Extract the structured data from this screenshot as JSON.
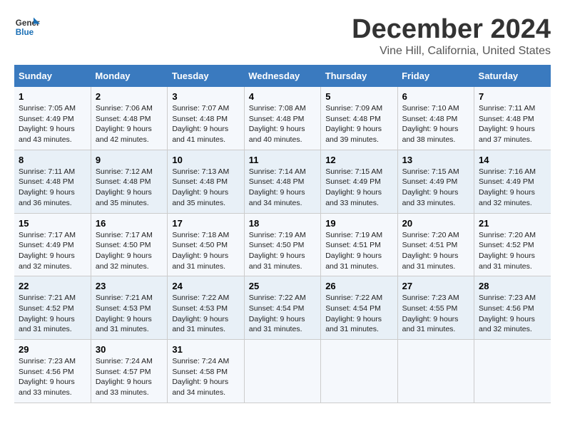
{
  "logo": {
    "line1": "General",
    "line2": "Blue"
  },
  "title": "December 2024",
  "location": "Vine Hill, California, United States",
  "header": {
    "days": [
      "Sunday",
      "Monday",
      "Tuesday",
      "Wednesday",
      "Thursday",
      "Friday",
      "Saturday"
    ]
  },
  "weeks": [
    [
      {
        "day": "1",
        "sunrise": "Sunrise: 7:05 AM",
        "sunset": "Sunset: 4:49 PM",
        "daylight": "Daylight: 9 hours and 43 minutes."
      },
      {
        "day": "2",
        "sunrise": "Sunrise: 7:06 AM",
        "sunset": "Sunset: 4:48 PM",
        "daylight": "Daylight: 9 hours and 42 minutes."
      },
      {
        "day": "3",
        "sunrise": "Sunrise: 7:07 AM",
        "sunset": "Sunset: 4:48 PM",
        "daylight": "Daylight: 9 hours and 41 minutes."
      },
      {
        "day": "4",
        "sunrise": "Sunrise: 7:08 AM",
        "sunset": "Sunset: 4:48 PM",
        "daylight": "Daylight: 9 hours and 40 minutes."
      },
      {
        "day": "5",
        "sunrise": "Sunrise: 7:09 AM",
        "sunset": "Sunset: 4:48 PM",
        "daylight": "Daylight: 9 hours and 39 minutes."
      },
      {
        "day": "6",
        "sunrise": "Sunrise: 7:10 AM",
        "sunset": "Sunset: 4:48 PM",
        "daylight": "Daylight: 9 hours and 38 minutes."
      },
      {
        "day": "7",
        "sunrise": "Sunrise: 7:11 AM",
        "sunset": "Sunset: 4:48 PM",
        "daylight": "Daylight: 9 hours and 37 minutes."
      }
    ],
    [
      {
        "day": "8",
        "sunrise": "Sunrise: 7:11 AM",
        "sunset": "Sunset: 4:48 PM",
        "daylight": "Daylight: 9 hours and 36 minutes."
      },
      {
        "day": "9",
        "sunrise": "Sunrise: 7:12 AM",
        "sunset": "Sunset: 4:48 PM",
        "daylight": "Daylight: 9 hours and 35 minutes."
      },
      {
        "day": "10",
        "sunrise": "Sunrise: 7:13 AM",
        "sunset": "Sunset: 4:48 PM",
        "daylight": "Daylight: 9 hours and 35 minutes."
      },
      {
        "day": "11",
        "sunrise": "Sunrise: 7:14 AM",
        "sunset": "Sunset: 4:48 PM",
        "daylight": "Daylight: 9 hours and 34 minutes."
      },
      {
        "day": "12",
        "sunrise": "Sunrise: 7:15 AM",
        "sunset": "Sunset: 4:49 PM",
        "daylight": "Daylight: 9 hours and 33 minutes."
      },
      {
        "day": "13",
        "sunrise": "Sunrise: 7:15 AM",
        "sunset": "Sunset: 4:49 PM",
        "daylight": "Daylight: 9 hours and 33 minutes."
      },
      {
        "day": "14",
        "sunrise": "Sunrise: 7:16 AM",
        "sunset": "Sunset: 4:49 PM",
        "daylight": "Daylight: 9 hours and 32 minutes."
      }
    ],
    [
      {
        "day": "15",
        "sunrise": "Sunrise: 7:17 AM",
        "sunset": "Sunset: 4:49 PM",
        "daylight": "Daylight: 9 hours and 32 minutes."
      },
      {
        "day": "16",
        "sunrise": "Sunrise: 7:17 AM",
        "sunset": "Sunset: 4:50 PM",
        "daylight": "Daylight: 9 hours and 32 minutes."
      },
      {
        "day": "17",
        "sunrise": "Sunrise: 7:18 AM",
        "sunset": "Sunset: 4:50 PM",
        "daylight": "Daylight: 9 hours and 31 minutes."
      },
      {
        "day": "18",
        "sunrise": "Sunrise: 7:19 AM",
        "sunset": "Sunset: 4:50 PM",
        "daylight": "Daylight: 9 hours and 31 minutes."
      },
      {
        "day": "19",
        "sunrise": "Sunrise: 7:19 AM",
        "sunset": "Sunset: 4:51 PM",
        "daylight": "Daylight: 9 hours and 31 minutes."
      },
      {
        "day": "20",
        "sunrise": "Sunrise: 7:20 AM",
        "sunset": "Sunset: 4:51 PM",
        "daylight": "Daylight: 9 hours and 31 minutes."
      },
      {
        "day": "21",
        "sunrise": "Sunrise: 7:20 AM",
        "sunset": "Sunset: 4:52 PM",
        "daylight": "Daylight: 9 hours and 31 minutes."
      }
    ],
    [
      {
        "day": "22",
        "sunrise": "Sunrise: 7:21 AM",
        "sunset": "Sunset: 4:52 PM",
        "daylight": "Daylight: 9 hours and 31 minutes."
      },
      {
        "day": "23",
        "sunrise": "Sunrise: 7:21 AM",
        "sunset": "Sunset: 4:53 PM",
        "daylight": "Daylight: 9 hours and 31 minutes."
      },
      {
        "day": "24",
        "sunrise": "Sunrise: 7:22 AM",
        "sunset": "Sunset: 4:53 PM",
        "daylight": "Daylight: 9 hours and 31 minutes."
      },
      {
        "day": "25",
        "sunrise": "Sunrise: 7:22 AM",
        "sunset": "Sunset: 4:54 PM",
        "daylight": "Daylight: 9 hours and 31 minutes."
      },
      {
        "day": "26",
        "sunrise": "Sunrise: 7:22 AM",
        "sunset": "Sunset: 4:54 PM",
        "daylight": "Daylight: 9 hours and 31 minutes."
      },
      {
        "day": "27",
        "sunrise": "Sunrise: 7:23 AM",
        "sunset": "Sunset: 4:55 PM",
        "daylight": "Daylight: 9 hours and 31 minutes."
      },
      {
        "day": "28",
        "sunrise": "Sunrise: 7:23 AM",
        "sunset": "Sunset: 4:56 PM",
        "daylight": "Daylight: 9 hours and 32 minutes."
      }
    ],
    [
      {
        "day": "29",
        "sunrise": "Sunrise: 7:23 AM",
        "sunset": "Sunset: 4:56 PM",
        "daylight": "Daylight: 9 hours and 33 minutes."
      },
      {
        "day": "30",
        "sunrise": "Sunrise: 7:24 AM",
        "sunset": "Sunset: 4:57 PM",
        "daylight": "Daylight: 9 hours and 33 minutes."
      },
      {
        "day": "31",
        "sunrise": "Sunrise: 7:24 AM",
        "sunset": "Sunset: 4:58 PM",
        "daylight": "Daylight: 9 hours and 34 minutes."
      },
      null,
      null,
      null,
      null
    ]
  ]
}
